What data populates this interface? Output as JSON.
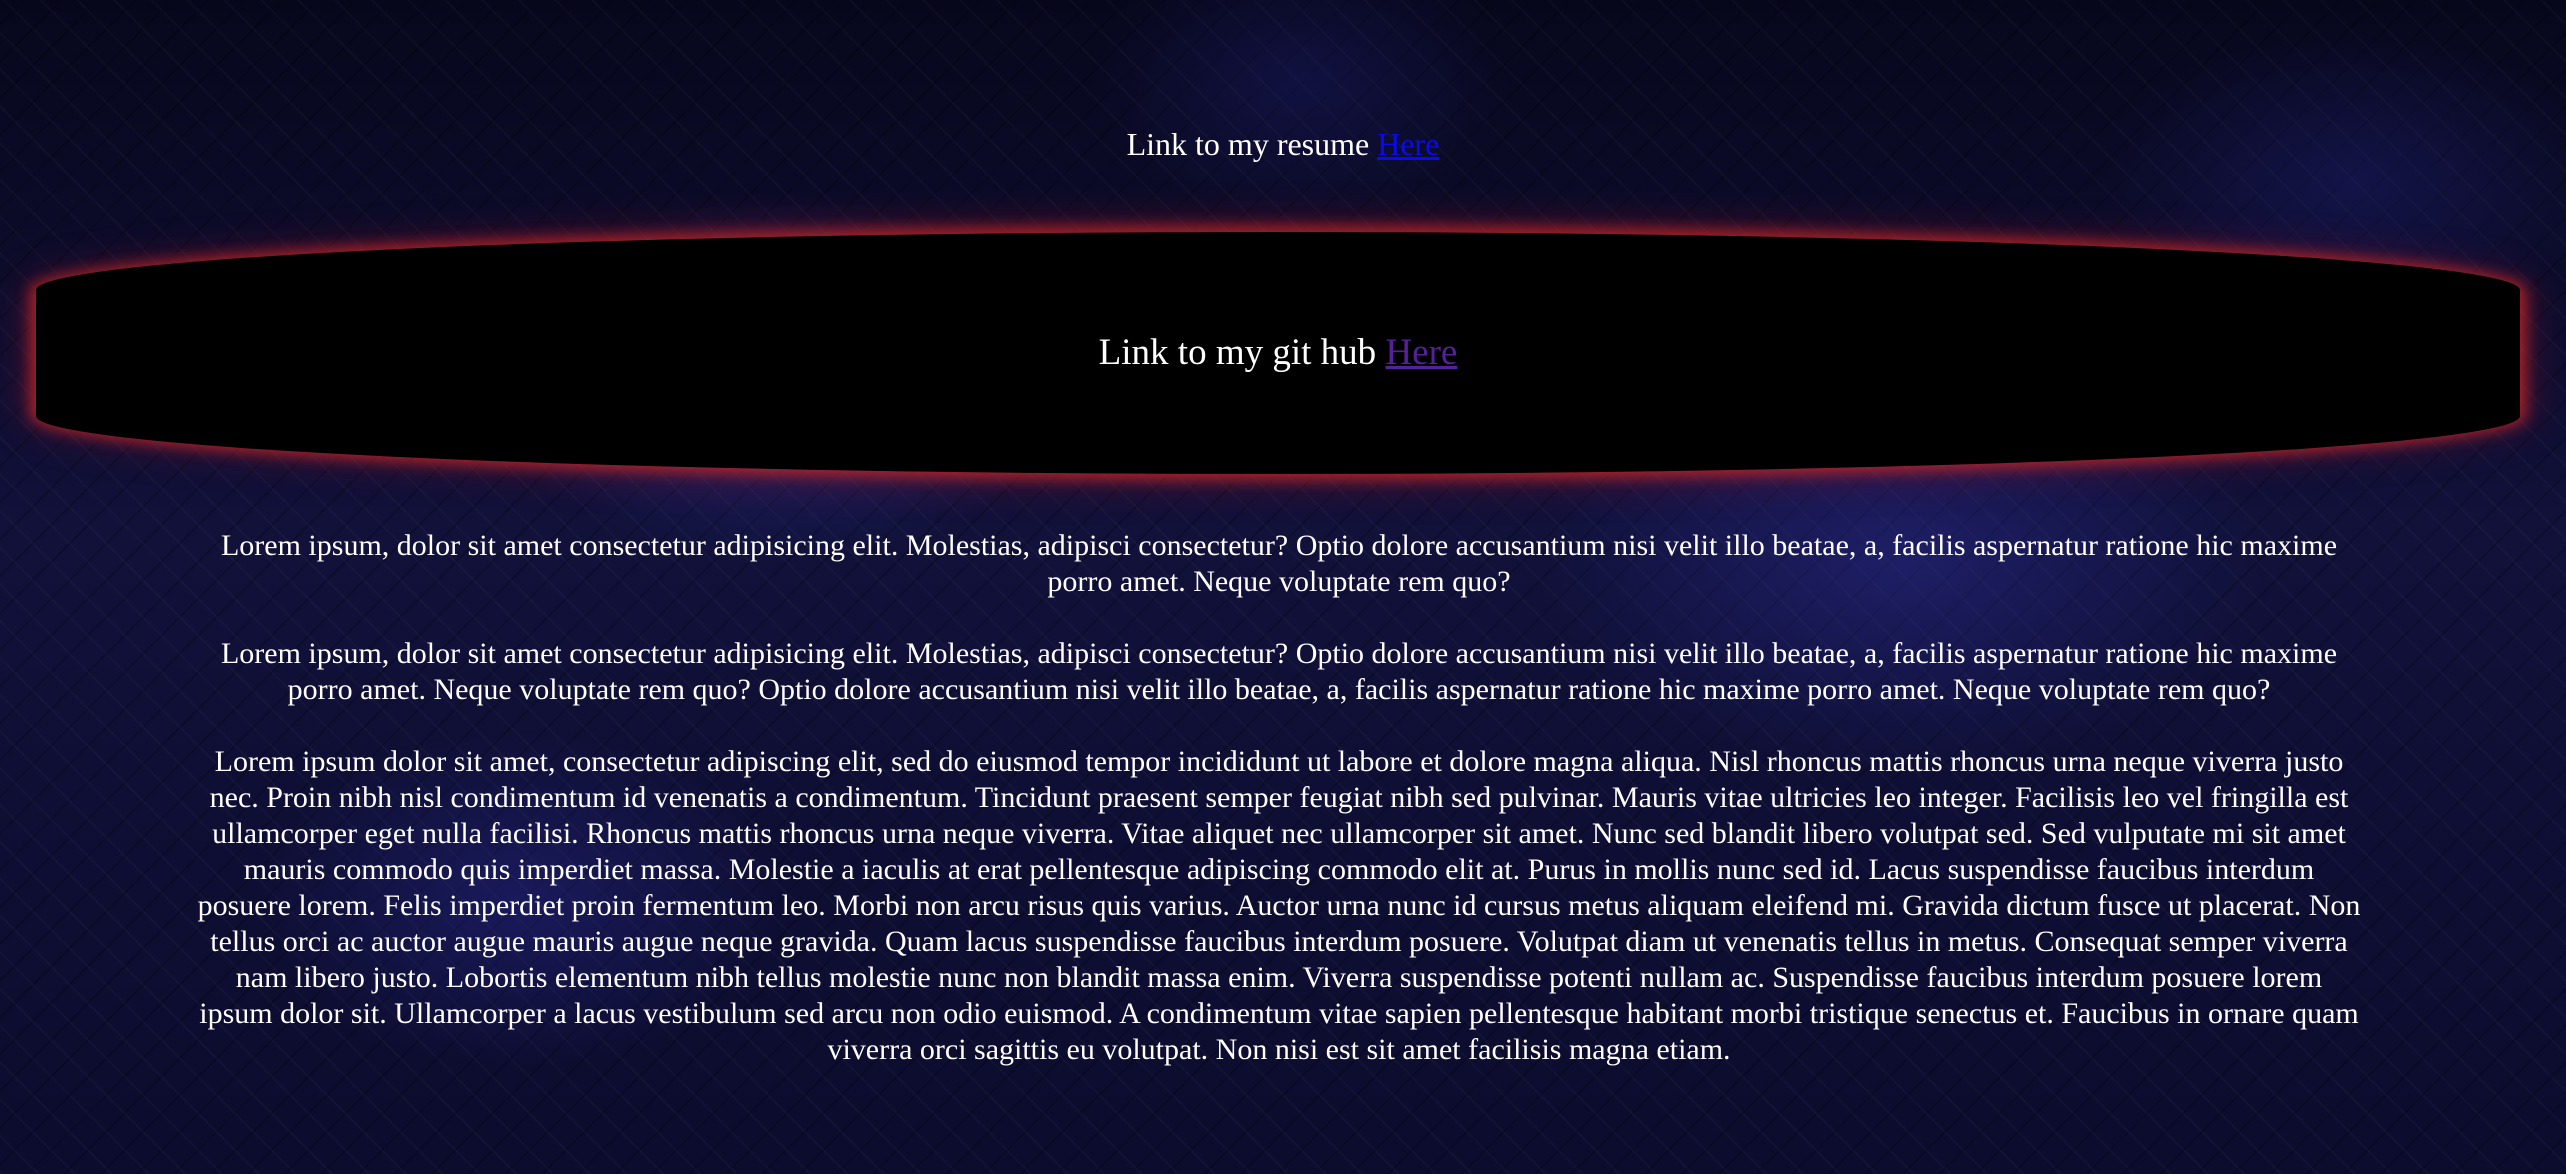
{
  "resume": {
    "text": "Link to my resume ",
    "link_label": "Here"
  },
  "github": {
    "text": "Link to my git hub ",
    "link_label": "Here"
  },
  "paragraphs": [
    "Lorem ipsum, dolor sit amet consectetur adipisicing elit. Molestias, adipisci consectetur? Optio dolore accusantium nisi velit illo beatae, a, facilis aspernatur ratione hic maxime porro amet. Neque voluptate rem quo?",
    "Lorem ipsum, dolor sit amet consectetur adipisicing elit. Molestias, adipisci consectetur? Optio dolore accusantium nisi velit illo beatae, a, facilis aspernatur ratione hic maxime porro amet. Neque voluptate rem quo? Optio dolore accusantium nisi velit illo beatae, a, facilis aspernatur ratione hic maxime porro amet. Neque voluptate rem quo?",
    "Lorem ipsum dolor sit amet, consectetur adipiscing elit, sed do eiusmod tempor incididunt ut labore et dolore magna aliqua. Nisl rhoncus mattis rhoncus urna neque viverra justo nec. Proin nibh nisl condimentum id venenatis a condimentum. Tincidunt praesent semper feugiat nibh sed pulvinar. Mauris vitae ultricies leo integer. Facilisis leo vel fringilla est ullamcorper eget nulla facilisi. Rhoncus mattis rhoncus urna neque viverra. Vitae aliquet nec ullamcorper sit amet. Nunc sed blandit libero volutpat sed. Sed vulputate mi sit amet mauris commodo quis imperdiet massa. Molestie a iaculis at erat pellentesque adipiscing commodo elit at. Purus in mollis nunc sed id. Lacus suspendisse faucibus interdum posuere lorem. Felis imperdiet proin fermentum leo. Morbi non arcu risus quis varius. Auctor urna nunc id cursus metus aliquam eleifend mi. Gravida dictum fusce ut placerat. Non tellus orci ac auctor augue mauris augue neque gravida. Quam lacus suspendisse faucibus interdum posuere. Volutpat diam ut venenatis tellus in metus. Consequat semper viverra nam libero justo. Lobortis elementum nibh tellus molestie nunc non blandit massa enim. Viverra suspendisse potenti nullam ac. Suspendisse faucibus interdum posuere lorem ipsum dolor sit. Ullamcorper a lacus vestibulum sed arcu non odio euismod. A condimentum vitae sapien pellentesque habitant morbi tristique senectus et. Faucibus in ornare quam viverra orci sagittis eu volutpat. Non nisi est sit amet facilisis magna etiam."
  ],
  "colors": {
    "link": "#0a0aee",
    "link_visited": "#55209a",
    "banner_glow": "#c82828",
    "text": "#ffffff"
  }
}
